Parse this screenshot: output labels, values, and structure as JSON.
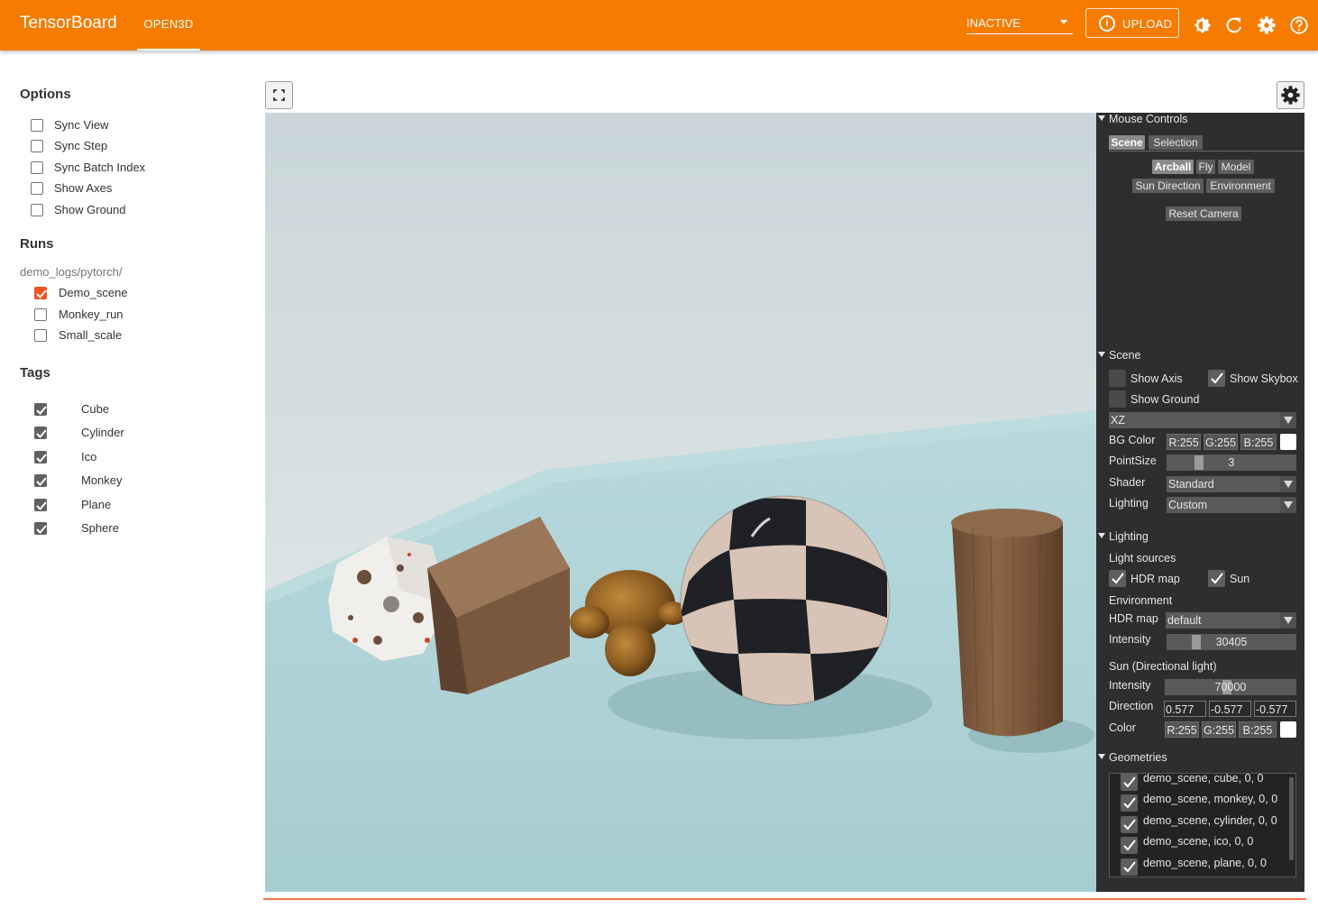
{
  "app": {
    "title": "TensorBoard",
    "active_tab": "OPEN3D",
    "run_select": "INACTIVE",
    "upload_label": "UPLOAD",
    "brand_color": "#f57c00"
  },
  "toolbar_icons": [
    "brightness-icon",
    "refresh-icon",
    "settings-icon",
    "help-icon"
  ],
  "left": {
    "options_title": "Options",
    "options": [
      {
        "label": "Sync View",
        "checked": false
      },
      {
        "label": "Sync Step",
        "checked": false
      },
      {
        "label": "Sync Batch Index",
        "checked": false
      },
      {
        "label": "Show Axes",
        "checked": false
      },
      {
        "label": "Show Ground",
        "checked": false
      }
    ],
    "runs_title": "Runs",
    "runs_prefix": "demo_logs/pytorch/",
    "runs": [
      {
        "label": "Demo_scene",
        "checked": true
      },
      {
        "label": "Monkey_run",
        "checked": false
      },
      {
        "label": "Small_scale",
        "checked": false
      }
    ],
    "tags_title": "Tags",
    "tags": [
      {
        "label": "Cube",
        "checked": true
      },
      {
        "label": "Cylinder",
        "checked": true
      },
      {
        "label": "Ico",
        "checked": true
      },
      {
        "label": "Monkey",
        "checked": true
      },
      {
        "label": "Plane",
        "checked": true
      },
      {
        "label": "Sphere",
        "checked": true
      }
    ]
  },
  "panel": {
    "mouse_controls": {
      "title": "Mouse Controls",
      "tabs": [
        "Scene",
        "Selection"
      ],
      "modes": [
        "Arcball",
        "Fly",
        "Model"
      ],
      "modes2": [
        "Sun Direction",
        "Environment"
      ],
      "reset": "Reset Camera"
    },
    "scene": {
      "title": "Scene",
      "show_axis": "Show Axis",
      "show_skybox": "Show Skybox",
      "show_ground": "Show Ground",
      "plane": "XZ",
      "bg_color_label": "BG Color",
      "bg_r": "R:255",
      "bg_g": "G:255",
      "bg_b": "B:255",
      "point_size_label": "PointSize",
      "point_size": "3",
      "shader_label": "Shader",
      "shader": "Standard",
      "lighting_label": "Lighting",
      "lighting": "Custom"
    },
    "lighting": {
      "title": "Lighting",
      "light_sources": "Light sources",
      "hdr_map_cb": "HDR map",
      "sun_cb": "Sun",
      "environment": "Environment",
      "hdr_map_label": "HDR map",
      "hdr_map": "default",
      "intensity_label": "Intensity",
      "intensity": "30405",
      "sun_title": "Sun (Directional light)",
      "sun_intensity_label": "Intensity",
      "sun_intensity": "70000",
      "direction_label": "Direction",
      "dir_x": "0.577",
      "dir_y": "-0.577",
      "dir_z": "-0.577",
      "color_label": "Color",
      "col_r": "R:255",
      "col_g": "G:255",
      "col_b": "B:255"
    },
    "geometries": {
      "title": "Geometries",
      "items": [
        "demo_scene, cube, 0, 0",
        "demo_scene, monkey, 0, 0",
        "demo_scene, cylinder, 0, 0",
        "demo_scene, ico, 0, 0",
        "demo_scene, plane, 0, 0"
      ]
    }
  }
}
